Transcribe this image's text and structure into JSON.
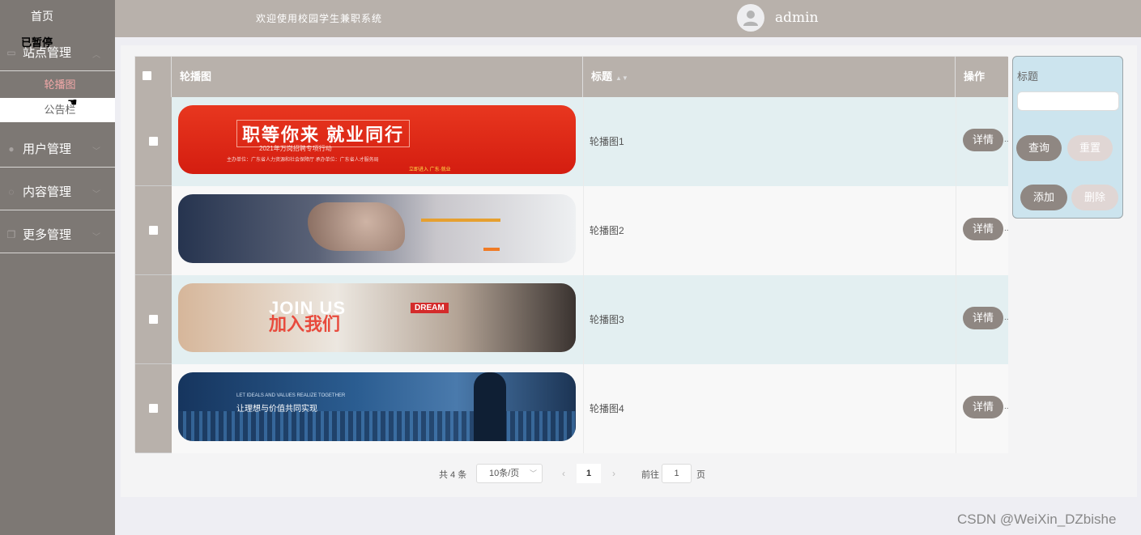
{
  "sidebar": {
    "home": "首页",
    "paused_overlay": "已暂停",
    "menus": [
      {
        "label": "站点管理",
        "icon": "monitor-icon"
      },
      {
        "label": "用户管理",
        "icon": "user-icon"
      },
      {
        "label": "内容管理",
        "icon": "chat-icon"
      },
      {
        "label": "更多管理",
        "icon": "copy-icon"
      }
    ],
    "sub_items": [
      {
        "label": "轮播图",
        "active": true
      },
      {
        "label": "公告栏",
        "active": false
      }
    ]
  },
  "header": {
    "welcome": "欢迎使用校园学生兼职系统",
    "username": "admin"
  },
  "table": {
    "columns": {
      "image": "轮播图",
      "title": "标题",
      "action": "操作"
    },
    "rows": [
      {
        "title": "轮播图1",
        "action": "详情"
      },
      {
        "title": "轮播图2",
        "action": "详情"
      },
      {
        "title": "轮播图3",
        "action": "详情"
      },
      {
        "title": "轮播图4",
        "action": "详情"
      }
    ],
    "dots": ".."
  },
  "banners": {
    "b1_headline": "职等你来  就业同行",
    "b1_sub": "2021年万岗招聘专项行动",
    "b1_small": "主办单位：广东省人力资源和社会保障厅    承办单位：广东省人才服务局",
    "b1_cta": "立即进入    广东·就业",
    "b3_line1": "JOIN US",
    "b3_line2": "加入我们",
    "b3_badge": "DREAM",
    "b4_small": "LET IDEALS AND VALUES REALIZE TOGETHER",
    "b4_text": "让理想与价值共同实现"
  },
  "pagination": {
    "total": "共 4 条",
    "page_size": "10条/页",
    "current_page": "1",
    "goto_label": "前往",
    "goto_value": "1",
    "goto_suffix": "页",
    "prev": "‹",
    "next": "›"
  },
  "search_panel": {
    "label": "标题",
    "input_value": "",
    "query": "查询",
    "reset": "重置",
    "add": "添加",
    "delete": "删除"
  },
  "watermark": "CSDN @WeiXin_DZbishe"
}
